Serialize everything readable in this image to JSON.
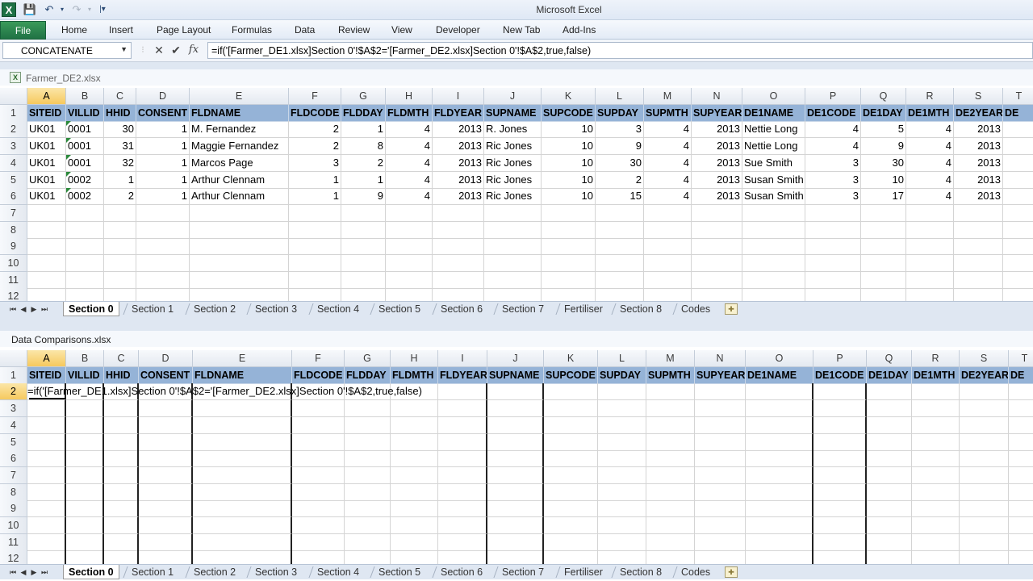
{
  "app": {
    "title": "Microsoft Excel",
    "logo_icon": "excel-logo-icon",
    "quick_access": [
      "save-icon",
      "undo-icon",
      "redo-icon",
      "customize-icon"
    ]
  },
  "ribbon": {
    "file_label": "File",
    "tabs": [
      "Home",
      "Insert",
      "Page Layout",
      "Formulas",
      "Data",
      "Review",
      "View",
      "Developer",
      "New Tab",
      "Add-Ins"
    ]
  },
  "formula_bar": {
    "name_box": "CONCATENATE",
    "cancel_icon": "✕",
    "enter_icon": "✔",
    "fx_label": "fx",
    "formula": "=if('[Farmer_DE1.xlsx]Section 0'!$A$2='[Farmer_DE2.xlsx]Section 0'!$A$2,true,false)"
  },
  "columns": [
    "A",
    "B",
    "C",
    "D",
    "E",
    "F",
    "G",
    "H",
    "I",
    "J",
    "K",
    "L",
    "M",
    "N",
    "O",
    "P",
    "Q",
    "R",
    "S",
    "T"
  ],
  "header_fields": [
    "SITEID",
    "VILLID",
    "HHID",
    "CONSENT",
    "FLDNAME",
    "FLDCODE",
    "FLDDAY",
    "FLDMTH",
    "FLDYEAR",
    "SUPNAME",
    "SUPCODE",
    "SUPDAY",
    "SUPMTH",
    "SUPYEAR",
    "DE1NAME",
    "DE1CODE",
    "DE1DAY",
    "DE1MTH",
    "DE2YEAR",
    "DE"
  ],
  "sheet_tabs": [
    "Section 0",
    "Section 1",
    "Section 2",
    "Section 3",
    "Section 4",
    "Section 5",
    "Section 6",
    "Section 7",
    "Fertiliser",
    "Section 8",
    "Codes"
  ],
  "top_workbook": {
    "title": "Farmer_DE2.xlsx",
    "icon": "excel-file-icon",
    "row_numbers": [
      "1",
      "2",
      "3",
      "4",
      "5",
      "6",
      "7",
      "8",
      "9",
      "10",
      "11",
      "12"
    ],
    "rows": [
      [
        "UK01",
        "0001",
        "30",
        "1",
        "M. Fernandez",
        "2",
        "1",
        "4",
        "2013",
        "R. Jones",
        "10",
        "3",
        "4",
        "2013",
        "Nettie Long",
        "4",
        "5",
        "4",
        "2013",
        ""
      ],
      [
        "UK01",
        "0001",
        "31",
        "1",
        "Maggie Fernandez",
        "2",
        "8",
        "4",
        "2013",
        "Ric Jones",
        "10",
        "9",
        "4",
        "2013",
        "Nettie Long",
        "4",
        "9",
        "4",
        "2013",
        ""
      ],
      [
        "UK01",
        "0001",
        "32",
        "1",
        "Marcos Page",
        "3",
        "2",
        "4",
        "2013",
        "Ric Jones",
        "10",
        "30",
        "4",
        "2013",
        "Sue Smith",
        "3",
        "30",
        "4",
        "2013",
        ""
      ],
      [
        "UK01",
        "0002",
        "1",
        "1",
        "Arthur Clennam",
        "1",
        "1",
        "4",
        "2013",
        "Ric Jones",
        "10",
        "2",
        "4",
        "2013",
        "Susan Smith",
        "3",
        "10",
        "4",
        "2013",
        ""
      ],
      [
        "UK01",
        "0002",
        "2",
        "1",
        "Arthur Clennam",
        "1",
        "9",
        "4",
        "2013",
        "Ric Jones",
        "10",
        "15",
        "4",
        "2013",
        "Susan Smith",
        "3",
        "17",
        "4",
        "2013",
        ""
      ]
    ]
  },
  "bottom_workbook": {
    "title": "Data Comparisons.xlsx",
    "row_numbers": [
      "1",
      "2",
      "3",
      "4",
      "5",
      "6",
      "7",
      "8",
      "9",
      "10",
      "11",
      "12"
    ],
    "editing_formula": "=if('[Farmer_DE1.xlsx]Section 0'!$A$2='[Farmer_DE2.xlsx]Section 0'!$A$2,true,false)"
  }
}
